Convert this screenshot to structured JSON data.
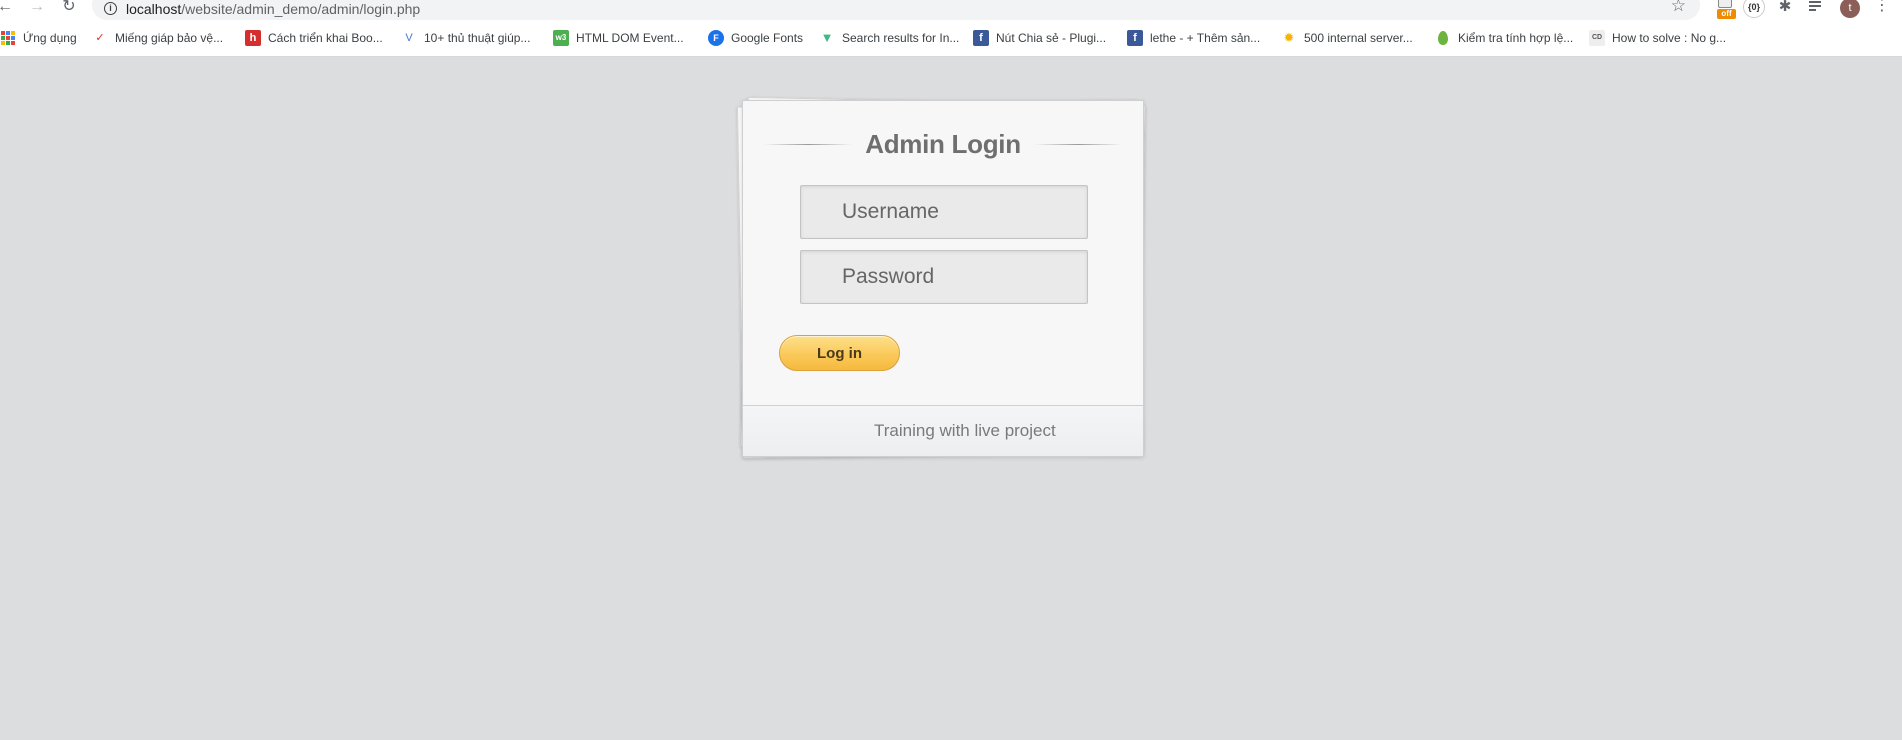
{
  "browser": {
    "url_host": "localhost",
    "url_path": "/website/admin_demo/admin/login.php",
    "avatar_letter": "t",
    "ext_off_label": "off",
    "ext_curly_label": "{0}"
  },
  "bookmarks": [
    {
      "label": "Ứng dụng",
      "icon": "apps-grid-icon"
    },
    {
      "label": "Miếng giáp bảo vệ...",
      "icon": "checkmark-icon",
      "color": "#d93025"
    },
    {
      "label": "Cách triển khai Boo...",
      "icon": "h-logo-icon",
      "color": "#d32f2f"
    },
    {
      "label": "10+ thủ thuật giúp...",
      "icon": "v-logo-icon",
      "color": "#4a76c6"
    },
    {
      "label": "HTML DOM Event...",
      "icon": "w3-logo-icon",
      "color": "#4caf50"
    },
    {
      "label": "Google Fonts",
      "icon": "f-circle-icon",
      "color": "#1a73e8"
    },
    {
      "label": "Search results for In...",
      "icon": "vue-logo-icon",
      "color": "#41b883"
    },
    {
      "label": "Nút Chia sẻ - Plugi...",
      "icon": "facebook-icon",
      "color": "#3b5998"
    },
    {
      "label": "lethe - + Thêm sản...",
      "icon": "facebook-icon",
      "color": "#3b5998"
    },
    {
      "label": "500 internal server...",
      "icon": "spark-icon",
      "color": "#f4b400"
    },
    {
      "label": "Kiểm tra tính hợp lệ...",
      "icon": "leaf-icon",
      "color": "#6db33f"
    },
    {
      "label": "How to solve : No g...",
      "icon": "cd-logo-icon",
      "color": "#555555"
    }
  ],
  "login": {
    "title": "Admin Login",
    "username_placeholder": "Username",
    "password_placeholder": "Password",
    "submit_label": "Log in",
    "footer_text": "Training with live project"
  },
  "colors": {
    "page_background": "#dcdddf",
    "button_gold": "#fbc95a",
    "title_gray": "#6f6f6f"
  }
}
